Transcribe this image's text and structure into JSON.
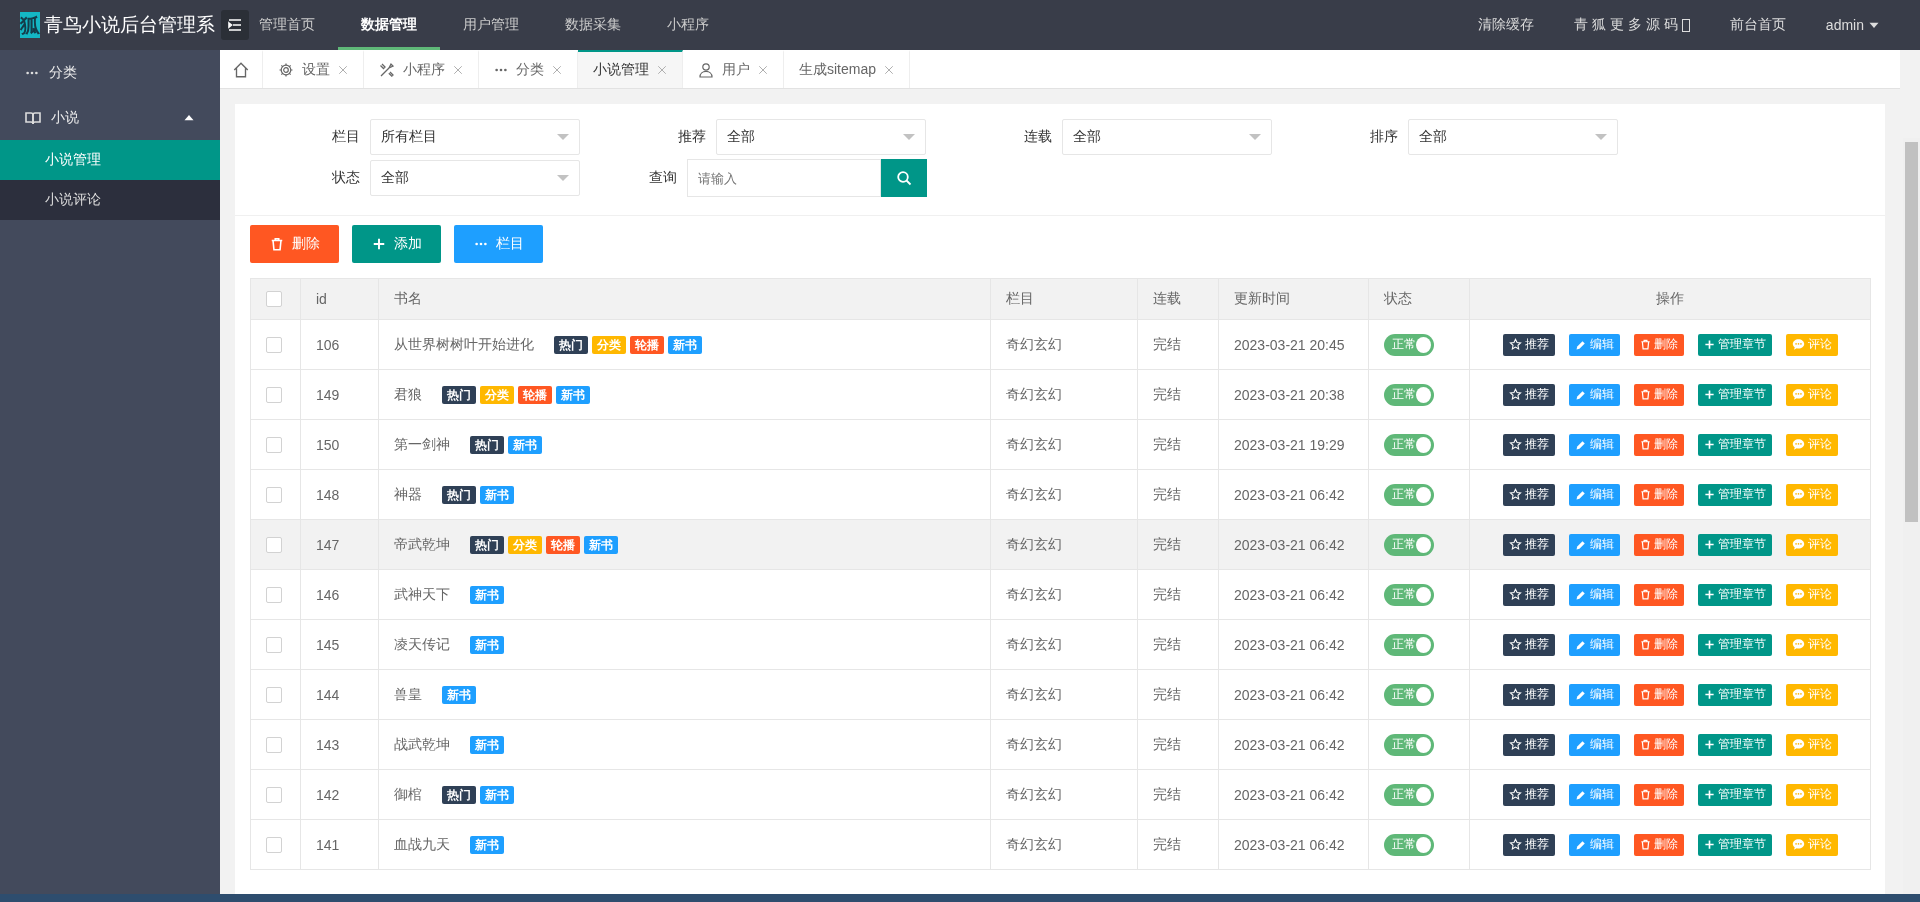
{
  "header": {
    "logo": "狐",
    "title": "青鸟小说后台管理系",
    "nav": [
      {
        "label": "管理首页",
        "selected": false
      },
      {
        "label": "数据管理",
        "selected": true
      },
      {
        "label": "用户管理",
        "selected": false
      },
      {
        "label": "数据采集",
        "selected": false
      },
      {
        "label": "小程序",
        "selected": false
      }
    ],
    "right": [
      {
        "label": "清除缓存",
        "kind": "link"
      },
      {
        "label": "青 狐 更 多 源 码",
        "kind": "missing-glyph"
      },
      {
        "label": "前台首页",
        "kind": "link"
      },
      {
        "label": "admin",
        "kind": "dropdown"
      }
    ]
  },
  "sidebar": {
    "items": [
      {
        "label": "分类",
        "kind": "dots"
      },
      {
        "label": "小说",
        "kind": "book",
        "expanded": true,
        "children": [
          {
            "label": "小说管理",
            "selected": true
          },
          {
            "label": "小说评论",
            "selected": false
          }
        ]
      }
    ]
  },
  "tabs": [
    {
      "kind": "home",
      "selected": false
    },
    {
      "label": "设置",
      "kind": "gear",
      "selected": false
    },
    {
      "label": "小程序",
      "kind": "tools",
      "selected": false
    },
    {
      "label": "分类",
      "kind": "dots",
      "selected": false
    },
    {
      "label": "小说管理",
      "kind": "none",
      "selected": true
    },
    {
      "label": "用户",
      "kind": "user",
      "selected": false
    },
    {
      "label": "生成sitemap",
      "kind": "none",
      "selected": false
    }
  ],
  "filters": [
    {
      "label": "栏目",
      "kind": "select",
      "value": "所有栏目"
    },
    {
      "label": "推荐",
      "kind": "select",
      "value": "全部"
    },
    {
      "label": "连载",
      "kind": "select",
      "value": "全部"
    },
    {
      "label": "排序",
      "kind": "select",
      "value": "全部"
    },
    {
      "label": "状态",
      "kind": "select",
      "value": "全部"
    },
    {
      "label": "查询",
      "kind": "search",
      "placeholder": "请输入"
    }
  ],
  "toolbar": [
    {
      "label": "删除",
      "kind": "delete"
    },
    {
      "label": "添加",
      "kind": "add"
    },
    {
      "label": "栏目",
      "kind": "column"
    }
  ],
  "table": {
    "select_all_checked": false,
    "columns": [
      "id",
      "书名",
      "栏目",
      "连载",
      "更新时间",
      "状态",
      "操作"
    ],
    "rows": [
      {
        "checked": false,
        "hovered": false,
        "id": "106",
        "title": "从世界树树叶开始进化",
        "tags": [
          {
            "label": "热门",
            "color": "#2f4056"
          },
          {
            "label": "分类",
            "color": "#ffb800"
          },
          {
            "label": "轮播",
            "color": "#ff5722"
          },
          {
            "label": "新书",
            "color": "#1e9fff"
          }
        ],
        "column": "奇幻玄幻",
        "serial": "完结",
        "updated": "2023-03-21 20:45",
        "status": {
          "label": "正常",
          "on": true
        },
        "actions": [
          "推荐",
          "编辑",
          "删除",
          "管理章节",
          "评论"
        ]
      },
      {
        "checked": false,
        "hovered": false,
        "id": "149",
        "title": "君狼",
        "tags": [
          {
            "label": "热门",
            "color": "#2f4056"
          },
          {
            "label": "分类",
            "color": "#ffb800"
          },
          {
            "label": "轮播",
            "color": "#ff5722"
          },
          {
            "label": "新书",
            "color": "#1e9fff"
          }
        ],
        "column": "奇幻玄幻",
        "serial": "完结",
        "updated": "2023-03-21 20:38",
        "status": {
          "label": "正常",
          "on": true
        },
        "actions": [
          "推荐",
          "编辑",
          "删除",
          "管理章节",
          "评论"
        ]
      },
      {
        "checked": false,
        "hovered": false,
        "id": "150",
        "title": "第一剑神",
        "tags": [
          {
            "label": "热门",
            "color": "#2f4056"
          },
          {
            "label": "新书",
            "color": "#1e9fff"
          }
        ],
        "column": "奇幻玄幻",
        "serial": "完结",
        "updated": "2023-03-21 19:29",
        "status": {
          "label": "正常",
          "on": true
        },
        "actions": [
          "推荐",
          "编辑",
          "删除",
          "管理章节",
          "评论"
        ]
      },
      {
        "checked": false,
        "hovered": false,
        "id": "148",
        "title": "神器",
        "tags": [
          {
            "label": "热门",
            "color": "#2f4056"
          },
          {
            "label": "新书",
            "color": "#1e9fff"
          }
        ],
        "column": "奇幻玄幻",
        "serial": "完结",
        "updated": "2023-03-21 06:42",
        "status": {
          "label": "正常",
          "on": true
        },
        "actions": [
          "推荐",
          "编辑",
          "删除",
          "管理章节",
          "评论"
        ]
      },
      {
        "checked": false,
        "hovered": true,
        "id": "147",
        "title": "帝武乾坤",
        "tags": [
          {
            "label": "热门",
            "color": "#2f4056"
          },
          {
            "label": "分类",
            "color": "#ffb800"
          },
          {
            "label": "轮播",
            "color": "#ff5722"
          },
          {
            "label": "新书",
            "color": "#1e9fff"
          }
        ],
        "column": "奇幻玄幻",
        "serial": "完结",
        "updated": "2023-03-21 06:42",
        "status": {
          "label": "正常",
          "on": true
        },
        "actions": [
          "推荐",
          "编辑",
          "删除",
          "管理章节",
          "评论"
        ]
      },
      {
        "checked": false,
        "hovered": false,
        "id": "146",
        "title": "武神天下",
        "tags": [
          {
            "label": "新书",
            "color": "#1e9fff"
          }
        ],
        "column": "奇幻玄幻",
        "serial": "完结",
        "updated": "2023-03-21 06:42",
        "status": {
          "label": "正常",
          "on": true
        },
        "actions": [
          "推荐",
          "编辑",
          "删除",
          "管理章节",
          "评论"
        ]
      },
      {
        "checked": false,
        "hovered": false,
        "id": "145",
        "title": "凌天传记",
        "tags": [
          {
            "label": "新书",
            "color": "#1e9fff"
          }
        ],
        "column": "奇幻玄幻",
        "serial": "完结",
        "updated": "2023-03-21 06:42",
        "status": {
          "label": "正常",
          "on": true
        },
        "actions": [
          "推荐",
          "编辑",
          "删除",
          "管理章节",
          "评论"
        ]
      },
      {
        "checked": false,
        "hovered": false,
        "id": "144",
        "title": "兽皇",
        "tags": [
          {
            "label": "新书",
            "color": "#1e9fff"
          }
        ],
        "column": "奇幻玄幻",
        "serial": "完结",
        "updated": "2023-03-21 06:42",
        "status": {
          "label": "正常",
          "on": true
        },
        "actions": [
          "推荐",
          "编辑",
          "删除",
          "管理章节",
          "评论"
        ]
      },
      {
        "checked": false,
        "hovered": false,
        "id": "143",
        "title": "战武乾坤",
        "tags": [
          {
            "label": "新书",
            "color": "#1e9fff"
          }
        ],
        "column": "奇幻玄幻",
        "serial": "完结",
        "updated": "2023-03-21 06:42",
        "status": {
          "label": "正常",
          "on": true
        },
        "actions": [
          "推荐",
          "编辑",
          "删除",
          "管理章节",
          "评论"
        ]
      },
      {
        "checked": false,
        "hovered": false,
        "id": "142",
        "title": "御棺",
        "tags": [
          {
            "label": "热门",
            "color": "#2f4056"
          },
          {
            "label": "新书",
            "color": "#1e9fff"
          }
        ],
        "column": "奇幻玄幻",
        "serial": "完结",
        "updated": "2023-03-21 06:42",
        "status": {
          "label": "正常",
          "on": true
        },
        "actions": [
          "推荐",
          "编辑",
          "删除",
          "管理章节",
          "评论"
        ]
      },
      {
        "checked": false,
        "hovered": false,
        "id": "141",
        "title": "血战九天",
        "tags": [
          {
            "label": "新书",
            "color": "#1e9fff"
          }
        ],
        "column": "奇幻玄幻",
        "serial": "完结",
        "updated": "2023-03-21 06:42",
        "status": {
          "label": "正常",
          "on": true
        },
        "actions": [
          "推荐",
          "编辑",
          "删除",
          "管理章节",
          "评论"
        ]
      }
    ]
  }
}
